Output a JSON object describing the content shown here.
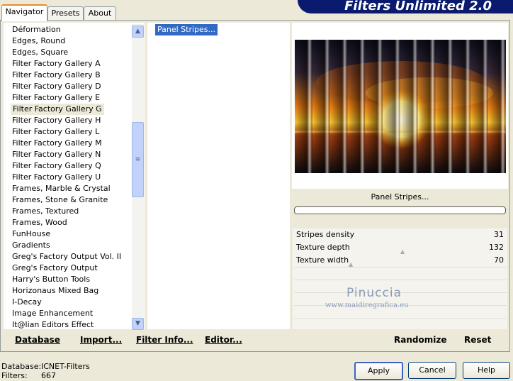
{
  "banner": {
    "title": "Filters Unlimited 2.0"
  },
  "tabs": [
    {
      "label": "Navigator"
    },
    {
      "label": "Presets"
    },
    {
      "label": "About"
    }
  ],
  "categories": [
    "Déformation",
    "Edges, Round",
    "Edges, Square",
    "Filter Factory Gallery A",
    "Filter Factory Gallery B",
    "Filter Factory Gallery D",
    "Filter Factory Gallery E",
    "Filter Factory Gallery G",
    "Filter Factory Gallery H",
    "Filter Factory Gallery L",
    "Filter Factory Gallery M",
    "Filter Factory Gallery N",
    "Filter Factory Gallery Q",
    "Filter Factory Gallery U",
    "Frames, Marble & Crystal",
    "Frames, Stone & Granite",
    "Frames, Textured",
    "Frames, Wood",
    "FunHouse",
    "Gradients",
    "Greg's Factory Output Vol. II",
    "Greg's Factory Output",
    "Harry's Button Tools",
    "Horizonaus Mixed Bag",
    "I-Decay",
    "Image Enhancement",
    "It@lian Editors Effect"
  ],
  "selected_category": "Filter Factory Gallery G",
  "filters": [
    "Panel Stripes..."
  ],
  "preview": {
    "filter_name": "Panel Stripes..."
  },
  "params": [
    {
      "label": "Stripes density",
      "value": "31"
    },
    {
      "label": "Texture depth",
      "value": "132"
    },
    {
      "label": "Texture width",
      "value": "70"
    }
  ],
  "watermark": {
    "name": "Pinuccia",
    "url": "www.maidiregrafica.eu"
  },
  "toolbar": {
    "database": "Database",
    "import": "Import...",
    "filter_info": "Filter Info...",
    "editor": "Editor...",
    "randomize": "Randomize",
    "reset": "Reset"
  },
  "status": {
    "database_label": "Database:",
    "database_value": "ICNET-Filters",
    "filters_label": "Filters:",
    "filters_value": "667"
  },
  "buttons": {
    "apply": "Apply",
    "cancel": "Cancel",
    "help": "Help"
  }
}
